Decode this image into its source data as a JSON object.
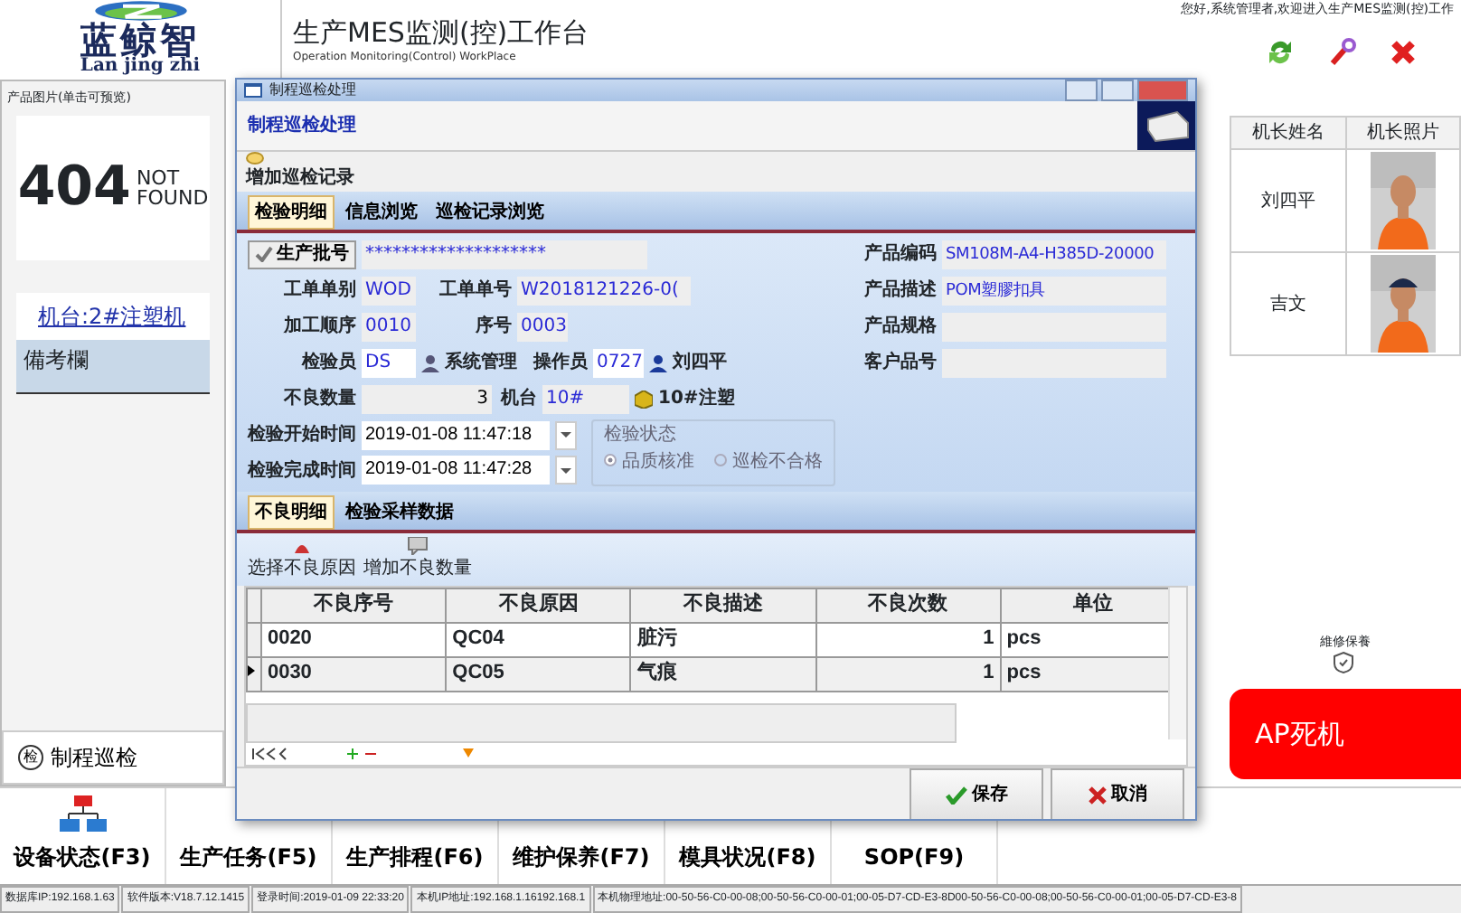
{
  "header": {
    "logo_text": "蓝鲸智",
    "logo_subtitle": "Lan jing zhi",
    "title": "生产MES监测(控)工作台",
    "subtitle": "Operation Monitoring(Control) WorkPlace",
    "welcome": "您好,系统管理者,欢迎进入生产MES监测(控)工作"
  },
  "left_panel": {
    "title": "产品图片(单击可预览)",
    "image_code": "404",
    "image_text": [
      "NOT",
      "FOUND"
    ],
    "machine_link": "机台:2#注塑机",
    "remarks_label": "備考欄",
    "action_icon": "检",
    "action_label": "制程巡检"
  },
  "right_panel": {
    "columns": [
      "机长姓名",
      "机长照片"
    ],
    "rows": [
      {
        "name": "刘四平"
      },
      {
        "name": "吉文"
      }
    ],
    "status_label": "維修保養",
    "alert_button": "AP死机"
  },
  "nav": [
    {
      "label": "设备状态(F3)",
      "kind": "network"
    },
    {
      "label": "生产任务(F5)",
      "kind": "hidden"
    },
    {
      "label": "生产排程(F6)",
      "kind": "hidden"
    },
    {
      "label": "维护保养(F7)",
      "kind": "hidden"
    },
    {
      "label": "模具状况(F8)",
      "kind": "hidden"
    },
    {
      "label": "SOP(F9)",
      "kind": "hidden"
    }
  ],
  "status_bar": [
    "数据库IP:192.168.1.63",
    "软件版本:V18.7.12.1415",
    "登录时间:2019-01-09 22:33:20",
    "本机IP地址:192.168.1.16192.168.1",
    "本机物理地址:00-50-56-C0-00-08;00-50-56-C0-00-01;00-05-D7-CD-E3-8D00-50-56-C0-00-08;00-50-56-C0-00-01;00-05-D7-CD-E3-8"
  ],
  "dialog": {
    "title": "制程巡检处理",
    "heading": "制程巡检处理",
    "add_record": "增加巡检记录",
    "tabs": [
      {
        "label": "检验明细",
        "selected": true
      },
      {
        "label": "信息浏览",
        "selected": false
      },
      {
        "label": "巡检记录浏览",
        "selected": false
      }
    ],
    "batch_button": "生产批号",
    "batch_value": "********************",
    "order_type": {
      "label": "工单单别",
      "value": "WOD"
    },
    "order_no": {
      "label": "工单单号",
      "value": "W2018121226-0("
    },
    "process_seq": {
      "label": "加工顺序",
      "value": "0010"
    },
    "seq_no": {
      "label": "序号",
      "value": "0003"
    },
    "inspector": {
      "label": "检验员",
      "value": "DS",
      "name": "系统管理"
    },
    "operator": {
      "label": "操作员",
      "value": "0727",
      "name": "刘四平"
    },
    "defect_qty": {
      "label": "不良数量",
      "value": "3"
    },
    "machine": {
      "label": "机台",
      "value": "10#",
      "name": "10#注塑"
    },
    "start_time": {
      "label": "检验开始时间",
      "value": "2019-01-08 11:47:18"
    },
    "end_time": {
      "label": "检验完成时间",
      "value": "2019-01-08 11:47:28"
    },
    "status_group": {
      "title": "检验状态",
      "options": [
        {
          "label": "品质核准",
          "selected": true
        },
        {
          "label": "巡检不合格",
          "selected": false
        }
      ]
    },
    "product_fields": [
      {
        "label": "产品编码",
        "value": "SM108M-A4-H385D-20000"
      },
      {
        "label": "产品描述",
        "value": "POM塑膠扣具"
      },
      {
        "label": "产品规格"
      },
      {
        "label": "客户品号"
      }
    ],
    "sub_tabs": [
      {
        "label": "不良明细",
        "selected": true
      },
      {
        "label": "检验采样数据",
        "selected": false
      }
    ],
    "sub_toolbar": [
      "选择不良原因",
      "增加不良数量"
    ],
    "grid": {
      "columns": [
        "不良序号",
        "不良原因",
        "不良描述",
        "不良次数",
        "单位"
      ],
      "rows": [
        {
          "cells": [
            "0020",
            "QC04",
            "脏污",
            "1",
            "pcs"
          ],
          "selected": false
        },
        {
          "cells": [
            "0030",
            "QC05",
            "气痕",
            "1",
            "pcs"
          ],
          "selected": true
        }
      ]
    },
    "buttons": [
      {
        "label": "保存",
        "kind": "save"
      },
      {
        "label": "取消",
        "kind": "cancel"
      }
    ]
  }
}
